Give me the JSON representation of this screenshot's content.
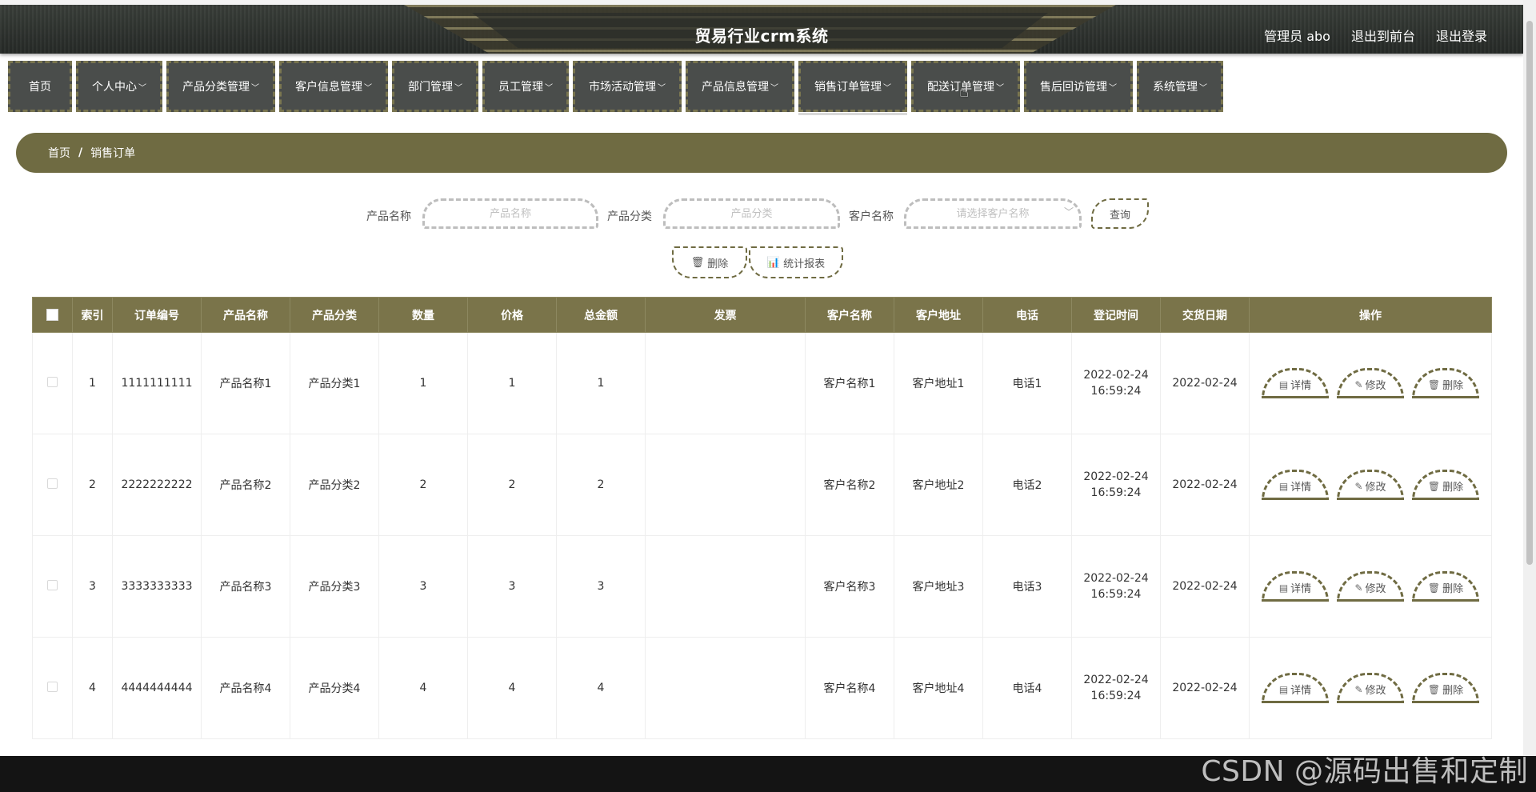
{
  "header": {
    "title": "贸易行业crm系统",
    "user_label": "管理员 abo",
    "front_link": "退出到前台",
    "logout_link": "退出登录"
  },
  "nav": [
    {
      "label": "首页",
      "has_menu": false
    },
    {
      "label": "个人中心",
      "has_menu": true
    },
    {
      "label": "产品分类管理",
      "has_menu": true
    },
    {
      "label": "客户信息管理",
      "has_menu": true
    },
    {
      "label": "部门管理",
      "has_menu": true
    },
    {
      "label": "员工管理",
      "has_menu": true
    },
    {
      "label": "市场活动管理",
      "has_menu": true
    },
    {
      "label": "产品信息管理",
      "has_menu": true
    },
    {
      "label": "销售订单管理",
      "has_menu": true
    },
    {
      "label": "配送订单管理",
      "has_menu": true
    },
    {
      "label": "售后回访管理",
      "has_menu": true
    },
    {
      "label": "系统管理",
      "has_menu": true
    }
  ],
  "breadcrumb": {
    "home": "首页",
    "sep": "/",
    "current": "销售订单"
  },
  "search": {
    "product_name_label": "产品名称",
    "product_name_placeholder": "产品名称",
    "category_label": "产品分类",
    "category_placeholder": "产品分类",
    "customer_label": "客户名称",
    "customer_placeholder": "请选择客户名称",
    "query_button": "查询"
  },
  "actions": {
    "delete": "删除",
    "report": "统计报表"
  },
  "table": {
    "headers": [
      "索引",
      "订单编号",
      "产品名称",
      "产品分类",
      "数量",
      "价格",
      "总金额",
      "发票",
      "客户名称",
      "客户地址",
      "电话",
      "登记时间",
      "交货日期",
      "操作"
    ],
    "rows": [
      {
        "index": "1",
        "order_no": "1111111111",
        "product": "产品名称1",
        "category": "产品分类1",
        "qty": "1",
        "price": "1",
        "total": "1",
        "invoice": "",
        "customer": "客户名称1",
        "address": "客户地址1",
        "phone": "电话1",
        "reg_date": "2022-02-24",
        "reg_time": "16:59:24",
        "delivery": "2022-02-24"
      },
      {
        "index": "2",
        "order_no": "2222222222",
        "product": "产品名称2",
        "category": "产品分类2",
        "qty": "2",
        "price": "2",
        "total": "2",
        "invoice": "",
        "customer": "客户名称2",
        "address": "客户地址2",
        "phone": "电话2",
        "reg_date": "2022-02-24",
        "reg_time": "16:59:24",
        "delivery": "2022-02-24"
      },
      {
        "index": "3",
        "order_no": "3333333333",
        "product": "产品名称3",
        "category": "产品分类3",
        "qty": "3",
        "price": "3",
        "total": "3",
        "invoice": "",
        "customer": "客户名称3",
        "address": "客户地址3",
        "phone": "电话3",
        "reg_date": "2022-02-24",
        "reg_time": "16:59:24",
        "delivery": "2022-02-24"
      },
      {
        "index": "4",
        "order_no": "4444444444",
        "product": "产品名称4",
        "category": "产品分类4",
        "qty": "4",
        "price": "4",
        "total": "4",
        "invoice": "",
        "customer": "客户名称4",
        "address": "客户地址4",
        "phone": "电话4",
        "reg_date": "2022-02-24",
        "reg_time": "16:59:24",
        "delivery": "2022-02-24"
      }
    ],
    "op_labels": {
      "detail": "详情",
      "edit": "修改",
      "delete": "删除"
    }
  },
  "watermark": "CSDN @源码出售和定制",
  "colors": {
    "accent": "#6f6b42",
    "header_bg": "#7a744a",
    "nav_bg": "#4a4d4b"
  }
}
